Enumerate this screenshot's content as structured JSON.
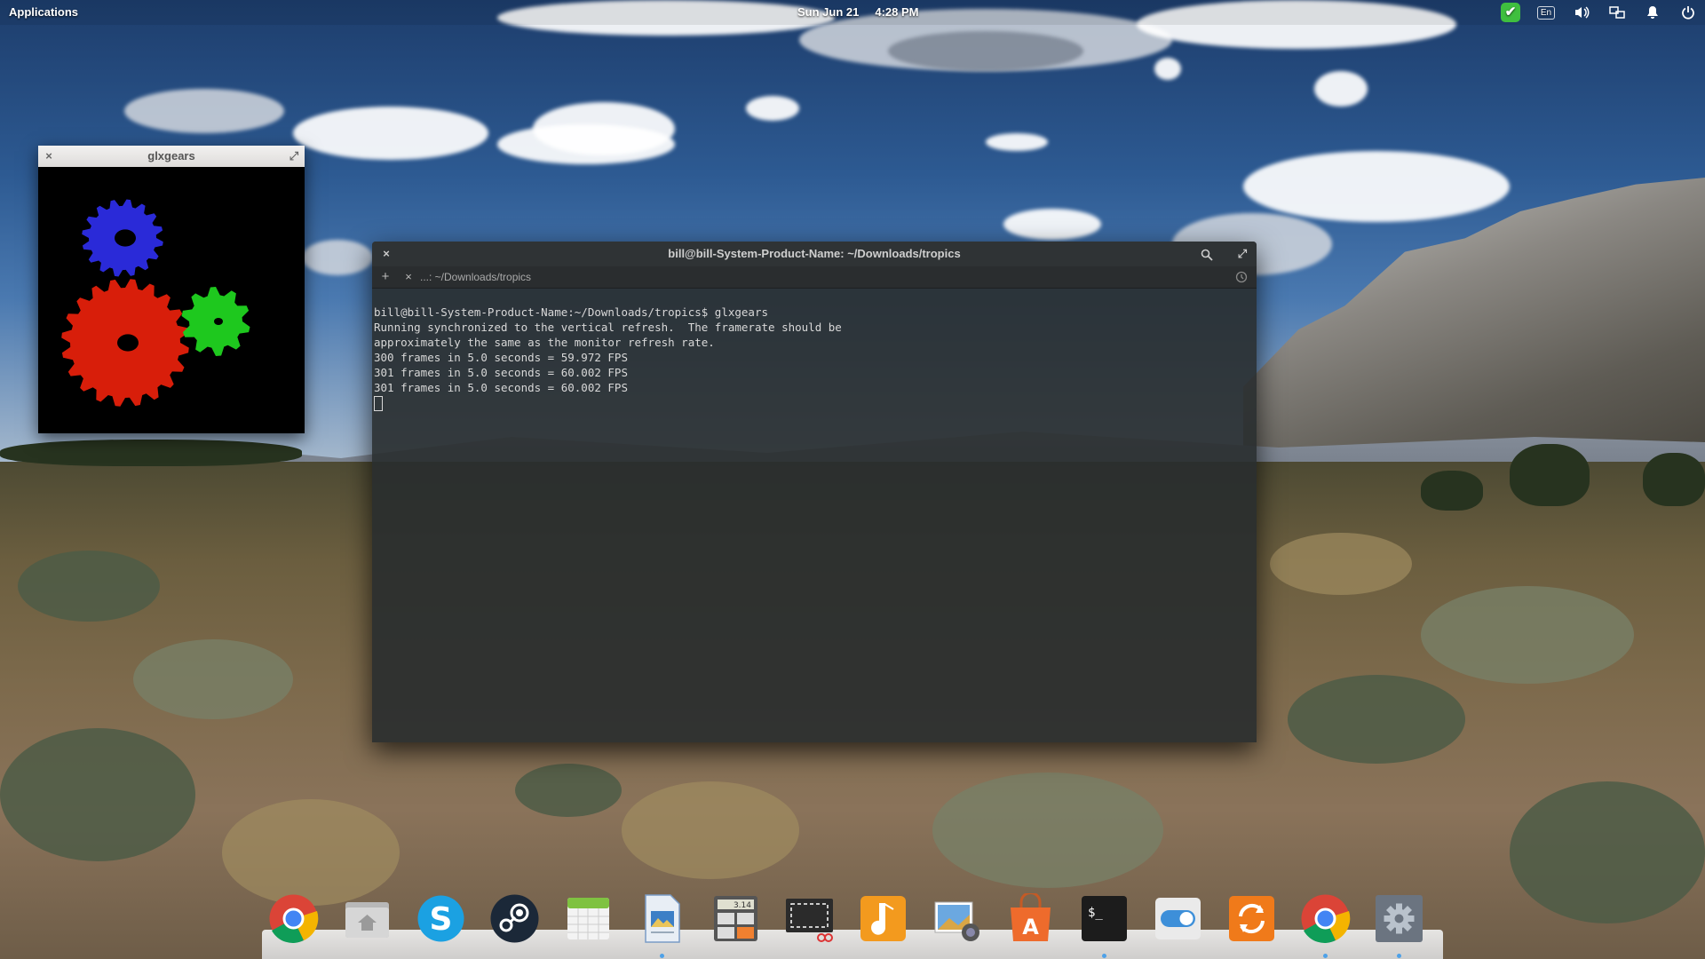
{
  "panel": {
    "applications_label": "Applications",
    "date": "Sun Jun 21",
    "time": "4:28 PM",
    "indicators": [
      {
        "name": "status-ok-icon",
        "glyph": "✔"
      },
      {
        "name": "keyboard-layout",
        "label": "En"
      },
      {
        "name": "volume-icon",
        "glyph": "🔊"
      },
      {
        "name": "network-icon",
        "glyph": "⊞"
      },
      {
        "name": "notifications-icon",
        "glyph": "🔔"
      },
      {
        "name": "power-icon",
        "glyph": "⏻"
      }
    ]
  },
  "glxgears": {
    "title": "glxgears",
    "close": "×",
    "maximize": "⤢",
    "gears": [
      {
        "color": "#2a2ad8",
        "name": "blue"
      },
      {
        "color": "#d81e0a",
        "name": "red"
      },
      {
        "color": "#1ec81e",
        "name": "green"
      }
    ]
  },
  "terminal": {
    "title": "bill@bill-System-Product-Name: ~/Downloads/tropics",
    "close": "×",
    "maximize": "⤢",
    "new_tab": "+",
    "tab_close": "×",
    "tab_label": "...: ~/Downloads/tropics",
    "lines": [
      "bill@bill-System-Product-Name:~/Downloads/tropics$ glxgears",
      "Running synchronized to the vertical refresh.  The framerate should be",
      "approximately the same as the monitor refresh rate.",
      "300 frames in 5.0 seconds = 59.972 FPS",
      "301 frames in 5.0 seconds = 60.002 FPS",
      "301 frames in 5.0 seconds = 60.002 FPS"
    ]
  },
  "dock": {
    "items": [
      {
        "name": "chrome-icon",
        "running": false
      },
      {
        "name": "files-icon",
        "running": false
      },
      {
        "name": "skype-icon",
        "running": false
      },
      {
        "name": "steam-icon",
        "running": false
      },
      {
        "name": "calendar-icon",
        "running": false
      },
      {
        "name": "text-document-icon",
        "running": true
      },
      {
        "name": "calculator-icon",
        "running": false
      },
      {
        "name": "screenshot-icon",
        "running": false
      },
      {
        "name": "music-icon",
        "running": false
      },
      {
        "name": "photos-icon",
        "running": false
      },
      {
        "name": "app-center-icon",
        "running": false
      },
      {
        "name": "terminal-icon",
        "running": true
      },
      {
        "name": "switchboard-toggle-icon",
        "running": false
      },
      {
        "name": "update-manager-icon",
        "running": false
      },
      {
        "name": "chrome-icon-2",
        "running": true
      },
      {
        "name": "settings-gear-icon",
        "running": true
      }
    ],
    "calc_display": "3.14",
    "terminal_glyph": "$_"
  },
  "colors": {
    "terminal_bg": "#282c2e",
    "terminal_text": "#d8d8d8",
    "dock_indicator": "#4ea1e8"
  }
}
